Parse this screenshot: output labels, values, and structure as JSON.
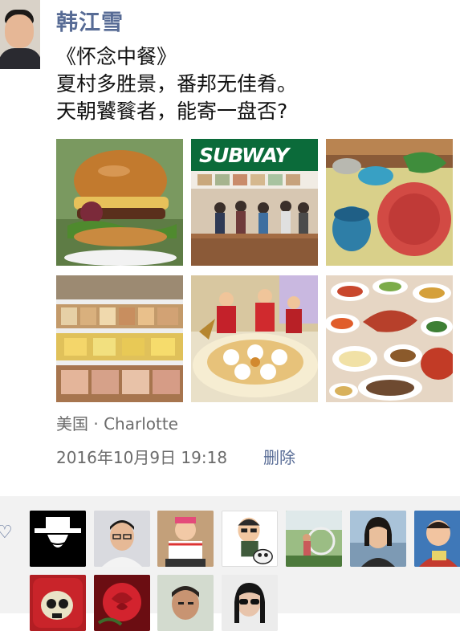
{
  "post": {
    "author": "韩江雪",
    "poem_lines": [
      "《怀念中餐》",
      "夏村多胜景，番邦无佳肴。",
      "天朝饕餮者，能寄一盘否?"
    ],
    "location": "美国 · Charlotte",
    "time": "2016年10月9日 19:18",
    "delete_label": "删除",
    "photos": [
      {
        "icon": "burger-photo"
      },
      {
        "icon": "subway-photo",
        "sign": "SUBWAY"
      },
      {
        "icon": "tableware-photo"
      },
      {
        "icon": "supermarket-photo"
      },
      {
        "icon": "banquet-photo"
      },
      {
        "icon": "dishes-photo"
      }
    ]
  },
  "likes": {
    "icon": "heart-icon",
    "count": 11
  },
  "colors": {
    "link": "#576b95",
    "meta": "#6b6b6b",
    "likes_bg": "#f2f2f2"
  }
}
